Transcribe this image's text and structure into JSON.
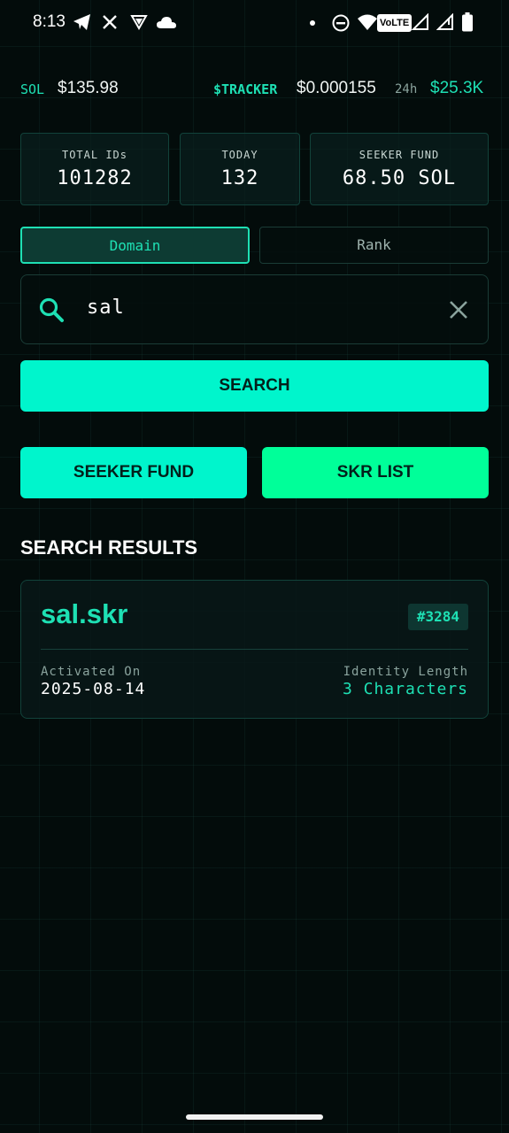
{
  "status_bar": {
    "time": "8:13",
    "left_icons": [
      "telegram-icon",
      "x-icon",
      "app-icon",
      "cloud-icon"
    ],
    "right_icons": [
      "dot-icon",
      "dnd-icon",
      "wifi-icon",
      "volte-icon",
      "signal-icon",
      "signal-icon-2",
      "battery-icon"
    ],
    "volte_label": "VoLTE"
  },
  "ticker": {
    "sol_label": "SOL",
    "sol_price": "$135.98",
    "tracker_label": "$TRACKER",
    "tracker_price": "$0.000155",
    "period_label": "24h",
    "volume": "$25.3K"
  },
  "stats": {
    "total_label": "TOTAL IDs",
    "total_value": "101282",
    "today_label": "TODAY",
    "today_value": "132",
    "fund_label": "SEEKER FUND",
    "fund_value": "68.50 SOL"
  },
  "toggle": {
    "domain_label": "Domain",
    "rank_label": "Rank",
    "active": "Domain"
  },
  "search": {
    "value": "sal",
    "button_label": "SEARCH"
  },
  "actions": {
    "fund_label": "SEEKER FUND",
    "skr_label": "SKR LIST"
  },
  "results": {
    "title": "SEARCH RESULTS",
    "items": [
      {
        "domain": "sal.skr",
        "rank": "#3284",
        "activated_label": "Activated On",
        "activated_value": "2025-08-14",
        "length_label": "Identity Length",
        "length_value": "3 Characters"
      }
    ]
  },
  "colors": {
    "accent": "#1ee0b4",
    "button_cyan": "#00f5cc",
    "button_green": "#00ff99",
    "background": "#030c0b"
  }
}
